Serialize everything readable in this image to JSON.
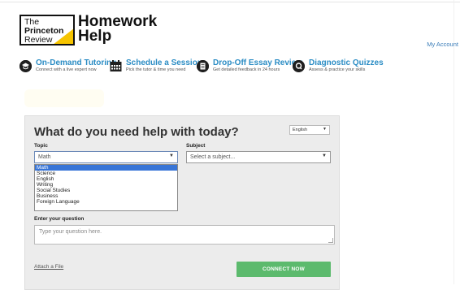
{
  "header": {
    "logo_lines": [
      "The",
      "Princeton",
      "Review"
    ],
    "brand_line1": "Homework",
    "brand_line2": "Help",
    "account_link": "My Account"
  },
  "nav": [
    {
      "title": "On-Demand Tutoring",
      "subtitle": "Connect with a live expert now",
      "icon": "tutor-icon"
    },
    {
      "title": "Schedule a Session",
      "subtitle": "Pick the tutor & time you need",
      "icon": "calendar-icon"
    },
    {
      "title": "Drop-Off Essay Review",
      "subtitle": "Get detailed feedback in 24 hours",
      "icon": "essay-icon"
    },
    {
      "title": "Diagnostic Quizzes",
      "subtitle": "Assess & practice your skills",
      "icon": "quiz-icon"
    }
  ],
  "form": {
    "title": "What do you need help with today?",
    "language_value": "English",
    "topic_label": "Topic",
    "topic_value": "Math",
    "subject_label": "Subject",
    "subject_placeholder": "Select a subject...",
    "topic_options": [
      "Math",
      "Science",
      "English",
      "Writing",
      "Social Studies",
      "Business",
      "Foreign Language"
    ],
    "topic_selected_index": 0,
    "question_label": "Enter your question",
    "question_placeholder": "Type your question here.",
    "attach_link": "Attach a File",
    "connect_button": "CONNECT NOW"
  },
  "colors": {
    "brand_blue": "#2a8cc4",
    "logo_yellow": "#f6c400",
    "connect_green": "#5cba6d",
    "selection_blue": "#3875d7"
  }
}
